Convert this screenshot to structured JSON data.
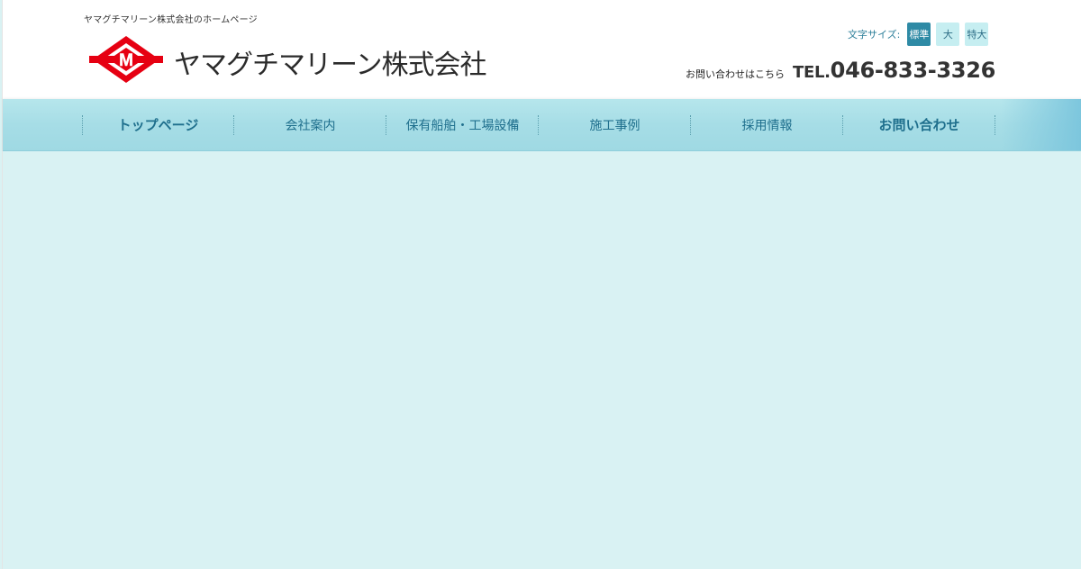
{
  "header": {
    "tagline": "ヤマグチマリーン株式会社のホームページ",
    "company_name": "ヤマグチマリーン株式会社",
    "logo_letter": "M",
    "logo_colors": {
      "primary": "#e60012",
      "inner": "#ffffff"
    }
  },
  "font_size": {
    "label": "文字サイズ:",
    "options": [
      "標準",
      "大",
      "特大"
    ],
    "selected": "標準"
  },
  "contact": {
    "label": "お問い合わせはこちら",
    "tel_prefix": "TEL.",
    "tel_number": "046-833-3326"
  },
  "nav": {
    "items": [
      {
        "label": "トップページ"
      },
      {
        "label": "会社案内"
      },
      {
        "label": "保有船舶・工場設備"
      },
      {
        "label": "施工事例"
      },
      {
        "label": "採用情報"
      },
      {
        "label": "お問い合わせ"
      }
    ]
  },
  "colors": {
    "accent": "#2e8aa5",
    "nav_text": "#1f6f8d",
    "background": "#d9f2f3"
  }
}
